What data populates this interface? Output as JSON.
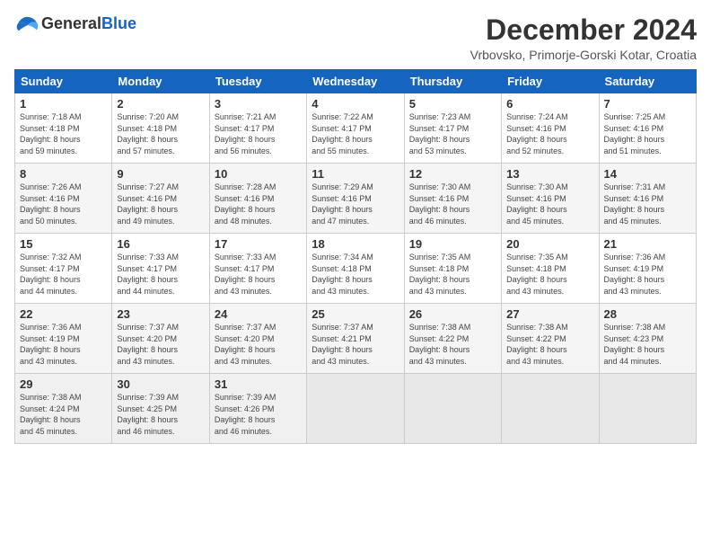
{
  "logo": {
    "text_general": "General",
    "text_blue": "Blue"
  },
  "title": {
    "month": "December 2024",
    "location": "Vrbovsko, Primorje-Gorski Kotar, Croatia"
  },
  "headers": [
    "Sunday",
    "Monday",
    "Tuesday",
    "Wednesday",
    "Thursday",
    "Friday",
    "Saturday"
  ],
  "weeks": [
    [
      {
        "day": "1",
        "info": "Sunrise: 7:18 AM\nSunset: 4:18 PM\nDaylight: 8 hours\nand 59 minutes."
      },
      {
        "day": "2",
        "info": "Sunrise: 7:20 AM\nSunset: 4:18 PM\nDaylight: 8 hours\nand 57 minutes."
      },
      {
        "day": "3",
        "info": "Sunrise: 7:21 AM\nSunset: 4:17 PM\nDaylight: 8 hours\nand 56 minutes."
      },
      {
        "day": "4",
        "info": "Sunrise: 7:22 AM\nSunset: 4:17 PM\nDaylight: 8 hours\nand 55 minutes."
      },
      {
        "day": "5",
        "info": "Sunrise: 7:23 AM\nSunset: 4:17 PM\nDaylight: 8 hours\nand 53 minutes."
      },
      {
        "day": "6",
        "info": "Sunrise: 7:24 AM\nSunset: 4:16 PM\nDaylight: 8 hours\nand 52 minutes."
      },
      {
        "day": "7",
        "info": "Sunrise: 7:25 AM\nSunset: 4:16 PM\nDaylight: 8 hours\nand 51 minutes."
      }
    ],
    [
      {
        "day": "8",
        "info": "Sunrise: 7:26 AM\nSunset: 4:16 PM\nDaylight: 8 hours\nand 50 minutes."
      },
      {
        "day": "9",
        "info": "Sunrise: 7:27 AM\nSunset: 4:16 PM\nDaylight: 8 hours\nand 49 minutes."
      },
      {
        "day": "10",
        "info": "Sunrise: 7:28 AM\nSunset: 4:16 PM\nDaylight: 8 hours\nand 48 minutes."
      },
      {
        "day": "11",
        "info": "Sunrise: 7:29 AM\nSunset: 4:16 PM\nDaylight: 8 hours\nand 47 minutes."
      },
      {
        "day": "12",
        "info": "Sunrise: 7:30 AM\nSunset: 4:16 PM\nDaylight: 8 hours\nand 46 minutes."
      },
      {
        "day": "13",
        "info": "Sunrise: 7:30 AM\nSunset: 4:16 PM\nDaylight: 8 hours\nand 45 minutes."
      },
      {
        "day": "14",
        "info": "Sunrise: 7:31 AM\nSunset: 4:16 PM\nDaylight: 8 hours\nand 45 minutes."
      }
    ],
    [
      {
        "day": "15",
        "info": "Sunrise: 7:32 AM\nSunset: 4:17 PM\nDaylight: 8 hours\nand 44 minutes."
      },
      {
        "day": "16",
        "info": "Sunrise: 7:33 AM\nSunset: 4:17 PM\nDaylight: 8 hours\nand 44 minutes."
      },
      {
        "day": "17",
        "info": "Sunrise: 7:33 AM\nSunset: 4:17 PM\nDaylight: 8 hours\nand 43 minutes."
      },
      {
        "day": "18",
        "info": "Sunrise: 7:34 AM\nSunset: 4:18 PM\nDaylight: 8 hours\nand 43 minutes."
      },
      {
        "day": "19",
        "info": "Sunrise: 7:35 AM\nSunset: 4:18 PM\nDaylight: 8 hours\nand 43 minutes."
      },
      {
        "day": "20",
        "info": "Sunrise: 7:35 AM\nSunset: 4:18 PM\nDaylight: 8 hours\nand 43 minutes."
      },
      {
        "day": "21",
        "info": "Sunrise: 7:36 AM\nSunset: 4:19 PM\nDaylight: 8 hours\nand 43 minutes."
      }
    ],
    [
      {
        "day": "22",
        "info": "Sunrise: 7:36 AM\nSunset: 4:19 PM\nDaylight: 8 hours\nand 43 minutes."
      },
      {
        "day": "23",
        "info": "Sunrise: 7:37 AM\nSunset: 4:20 PM\nDaylight: 8 hours\nand 43 minutes."
      },
      {
        "day": "24",
        "info": "Sunrise: 7:37 AM\nSunset: 4:20 PM\nDaylight: 8 hours\nand 43 minutes."
      },
      {
        "day": "25",
        "info": "Sunrise: 7:37 AM\nSunset: 4:21 PM\nDaylight: 8 hours\nand 43 minutes."
      },
      {
        "day": "26",
        "info": "Sunrise: 7:38 AM\nSunset: 4:22 PM\nDaylight: 8 hours\nand 43 minutes."
      },
      {
        "day": "27",
        "info": "Sunrise: 7:38 AM\nSunset: 4:22 PM\nDaylight: 8 hours\nand 43 minutes."
      },
      {
        "day": "28",
        "info": "Sunrise: 7:38 AM\nSunset: 4:23 PM\nDaylight: 8 hours\nand 44 minutes."
      }
    ],
    [
      {
        "day": "29",
        "info": "Sunrise: 7:38 AM\nSunset: 4:24 PM\nDaylight: 8 hours\nand 45 minutes."
      },
      {
        "day": "30",
        "info": "Sunrise: 7:39 AM\nSunset: 4:25 PM\nDaylight: 8 hours\nand 46 minutes."
      },
      {
        "day": "31",
        "info": "Sunrise: 7:39 AM\nSunset: 4:26 PM\nDaylight: 8 hours\nand 46 minutes."
      },
      {
        "day": "",
        "info": ""
      },
      {
        "day": "",
        "info": ""
      },
      {
        "day": "",
        "info": ""
      },
      {
        "day": "",
        "info": ""
      }
    ]
  ]
}
